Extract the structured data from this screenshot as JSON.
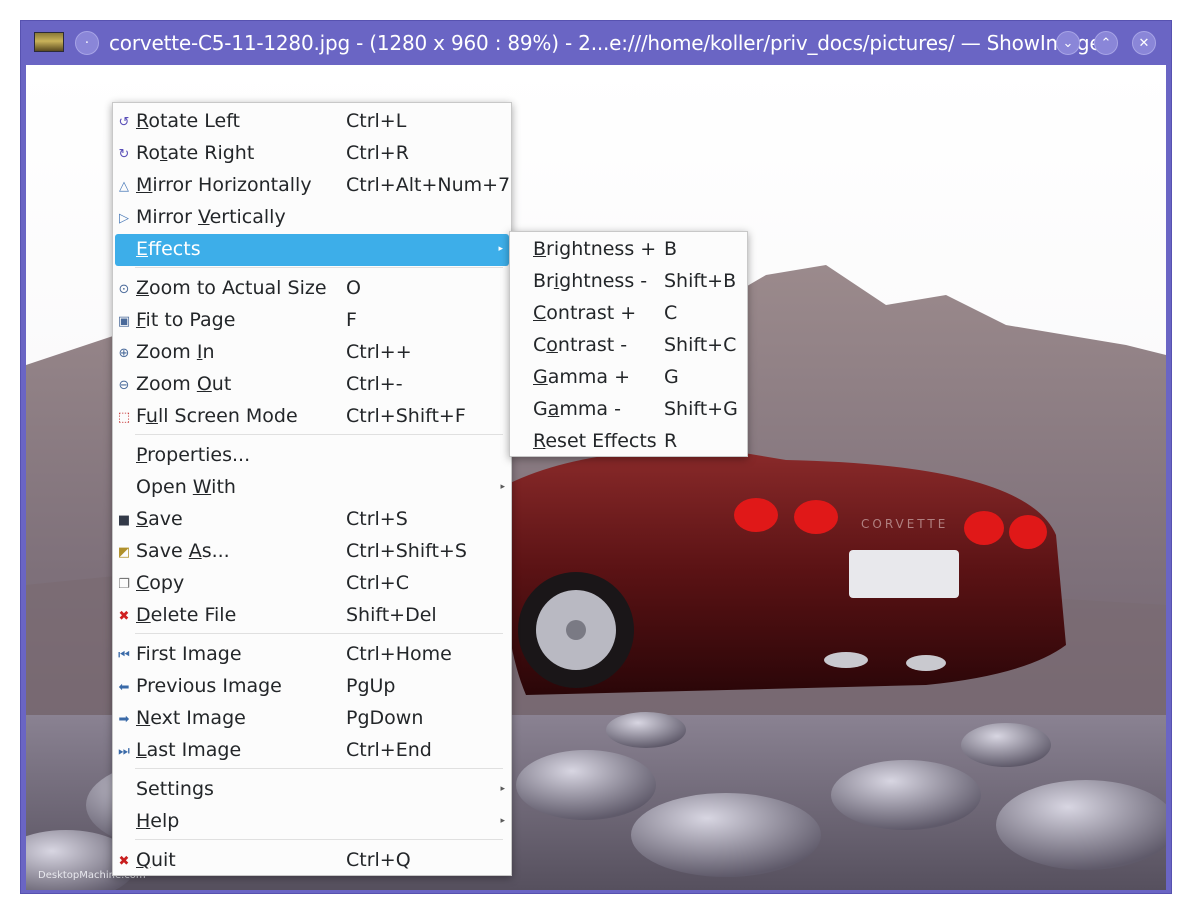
{
  "window": {
    "title": "corvette-C5-11-1280.jpg - (1280 x 960 : 89%) - 2...e:///home/koller/priv_docs/pictures/ — ShowImage",
    "buttons": {
      "menu": "·",
      "minimize": "⌄",
      "maximize": "⌃",
      "close": "✕"
    }
  },
  "image": {
    "watermark": "DesktopMachine.com",
    "car_badge": "CORVETTE"
  },
  "menu": {
    "items": [
      {
        "pre": "",
        "u": "R",
        "post": "otate Left",
        "shortcut": "Ctrl+L",
        "icon": "rotate-left-icon",
        "glyph": "↺"
      },
      {
        "pre": "Ro",
        "u": "t",
        "post": "ate Right",
        "shortcut": "Ctrl+R",
        "icon": "rotate-right-icon",
        "glyph": "↻"
      },
      {
        "pre": "",
        "u": "M",
        "post": "irror Horizontally",
        "shortcut": "Ctrl+Alt+Num+7",
        "icon": "mirror-horizontal-icon",
        "glyph": "△"
      },
      {
        "pre": "Mirror ",
        "u": "V",
        "post": "ertically",
        "shortcut": "",
        "icon": "mirror-vertical-icon",
        "glyph": "▷"
      },
      {
        "pre": "",
        "u": "E",
        "post": "ffects",
        "shortcut": "",
        "icon": "",
        "glyph": ""
      },
      {
        "pre": "",
        "u": "Z",
        "post": "oom to Actual Size",
        "shortcut": "O",
        "icon": "zoom-actual-icon",
        "glyph": "⊙"
      },
      {
        "pre": "",
        "u": "F",
        "post": "it to Page",
        "shortcut": "F",
        "icon": "fit-page-icon",
        "glyph": "▣"
      },
      {
        "pre": "Zoom ",
        "u": "I",
        "post": "n",
        "shortcut": "Ctrl++",
        "icon": "zoom-in-icon",
        "glyph": "⊕"
      },
      {
        "pre": "Zoom ",
        "u": "O",
        "post": "ut",
        "shortcut": "Ctrl+-",
        "icon": "zoom-out-icon",
        "glyph": "⊖"
      },
      {
        "pre": "F",
        "u": "u",
        "post": "ll Screen Mode",
        "shortcut": "Ctrl+Shift+F",
        "icon": "fullscreen-icon",
        "glyph": "⬚"
      },
      {
        "pre": "",
        "u": "P",
        "post": "roperties...",
        "shortcut": "",
        "icon": "",
        "glyph": ""
      },
      {
        "pre": "Open ",
        "u": "W",
        "post": "ith",
        "shortcut": "",
        "icon": "",
        "glyph": ""
      },
      {
        "pre": "",
        "u": "S",
        "post": "ave",
        "shortcut": "Ctrl+S",
        "icon": "save-icon",
        "glyph": "■"
      },
      {
        "pre": "Save ",
        "u": "A",
        "post": "s...",
        "shortcut": "Ctrl+Shift+S",
        "icon": "save-as-icon",
        "glyph": "◩"
      },
      {
        "pre": "",
        "u": "C",
        "post": "opy",
        "shortcut": "Ctrl+C",
        "icon": "copy-icon",
        "glyph": "❐"
      },
      {
        "pre": "",
        "u": "D",
        "post": "elete File",
        "shortcut": "Shift+Del",
        "icon": "delete-icon",
        "glyph": "✖"
      },
      {
        "pre": "First Image",
        "u": "",
        "post": "",
        "shortcut": "Ctrl+Home",
        "icon": "first-image-icon",
        "glyph": "⏮"
      },
      {
        "pre": "Previous Image",
        "u": "",
        "post": "",
        "shortcut": "PgUp",
        "icon": "previous-image-icon",
        "glyph": "⬅"
      },
      {
        "pre": "",
        "u": "N",
        "post": "ext Image",
        "shortcut": "PgDown",
        "icon": "next-image-icon",
        "glyph": "➡"
      },
      {
        "pre": "",
        "u": "L",
        "post": "ast Image",
        "shortcut": "Ctrl+End",
        "icon": "last-image-icon",
        "glyph": "⏭"
      },
      {
        "pre": "Settings",
        "u": "",
        "post": "",
        "shortcut": "",
        "icon": "",
        "glyph": ""
      },
      {
        "pre": "",
        "u": "H",
        "post": "elp",
        "shortcut": "",
        "icon": "",
        "glyph": ""
      },
      {
        "pre": "",
        "u": "Q",
        "post": "uit",
        "shortcut": "Ctrl+Q",
        "icon": "quit-icon",
        "glyph": "✖"
      }
    ]
  },
  "effects_menu": {
    "items": [
      {
        "pre": "",
        "u": "B",
        "post": "rightness +",
        "shortcut": "B"
      },
      {
        "pre": "Br",
        "u": "i",
        "post": "ghtness -",
        "shortcut": "Shift+B"
      },
      {
        "pre": "",
        "u": "C",
        "post": "ontrast +",
        "shortcut": "C"
      },
      {
        "pre": "C",
        "u": "o",
        "post": "ntrast -",
        "shortcut": "Shift+C"
      },
      {
        "pre": "",
        "u": "G",
        "post": "amma +",
        "shortcut": "G"
      },
      {
        "pre": "G",
        "u": "a",
        "post": "mma -",
        "shortcut": "Shift+G"
      },
      {
        "pre": "",
        "u": "R",
        "post": "eset Effects",
        "shortcut": "R"
      }
    ]
  },
  "colors": {
    "highlight": "#3daee9",
    "titlebar": "#6a65c4"
  }
}
